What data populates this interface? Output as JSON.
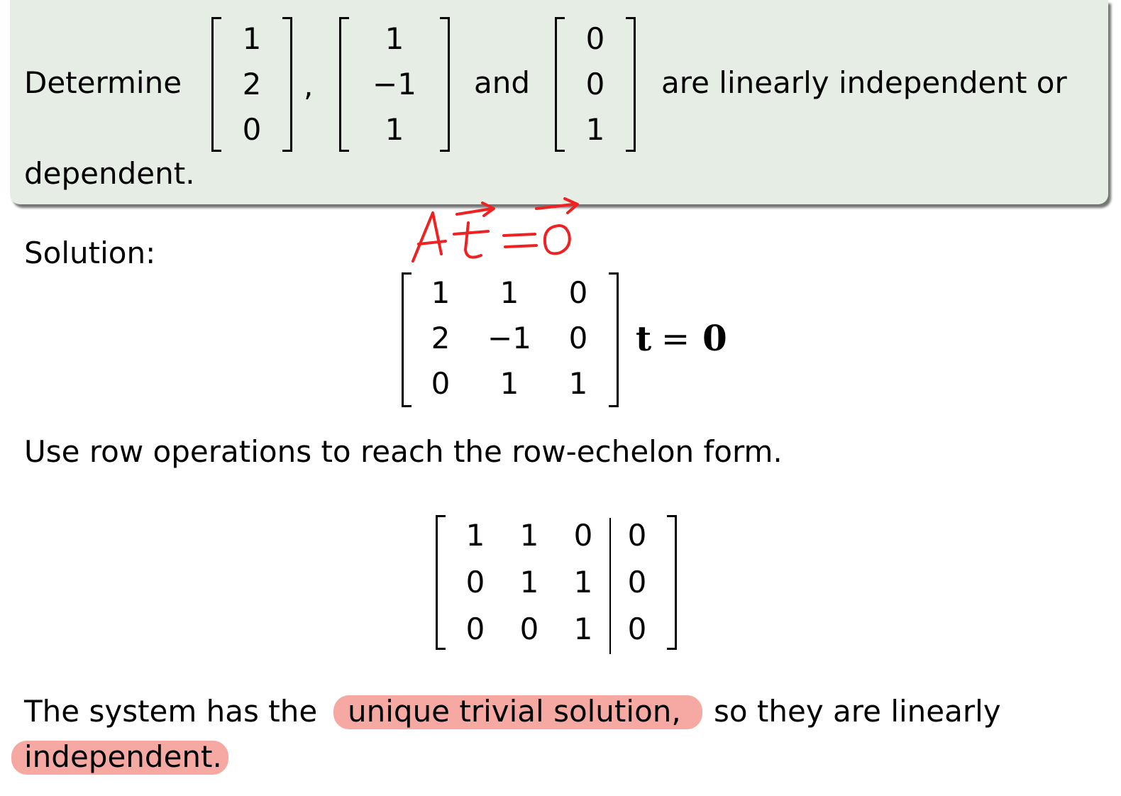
{
  "problem": {
    "prefix": "Determine",
    "comma": ",",
    "and": "and",
    "suffix": "are linearly independent or",
    "continuation": "dependent.",
    "vectors": [
      [
        "1",
        "2",
        "0"
      ],
      [
        "1",
        "−1",
        "1"
      ],
      [
        "0",
        "0",
        "1"
      ]
    ]
  },
  "solution_label": "Solution:",
  "handwritten_note": "A t = 0",
  "system": {
    "matrix": [
      [
        "1",
        "1",
        "0"
      ],
      [
        "2",
        "−1",
        "0"
      ],
      [
        "0",
        "1",
        "1"
      ]
    ],
    "t_symbol": "t",
    "equals": "=",
    "zero": "0"
  },
  "instruction": "Use row operations to reach the row-echelon form.",
  "echelon": {
    "matrix": [
      [
        "1",
        "1",
        "0",
        "0"
      ],
      [
        "0",
        "1",
        "1",
        "0"
      ],
      [
        "0",
        "0",
        "1",
        "0"
      ]
    ]
  },
  "conclusion": {
    "part1": "The system has the",
    "highlight1": "unique trivial solution,",
    "part2": "so they are linearly",
    "highlight2": "independent."
  },
  "colors": {
    "box_bg": "#e5ede5",
    "highlight": "#f6a9a2",
    "ink": "#ee2222"
  }
}
